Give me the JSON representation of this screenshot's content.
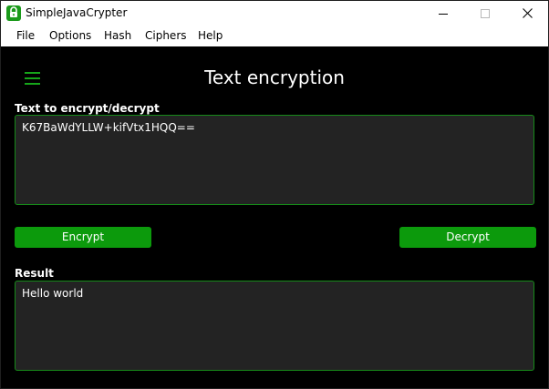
{
  "window": {
    "title": "SimpleJavaCrypter",
    "controls": [
      "minimize-icon",
      "maximize-icon",
      "close-icon"
    ]
  },
  "menu": {
    "items": [
      "File",
      "Options",
      "Hash",
      "Ciphers",
      "Help"
    ]
  },
  "page": {
    "title": "Text encryption"
  },
  "input": {
    "label": "Text to encrypt/decrypt",
    "value": "K67BaWdYLLW+kifVtx1HQQ=="
  },
  "actions": {
    "encrypt_label": "Encrypt",
    "decrypt_label": "Decrypt"
  },
  "result": {
    "label": "Result",
    "value": "Hello world"
  },
  "colors": {
    "accent": "#0c9a0c",
    "border": "#168a19",
    "background": "#000000",
    "field": "#232323"
  }
}
